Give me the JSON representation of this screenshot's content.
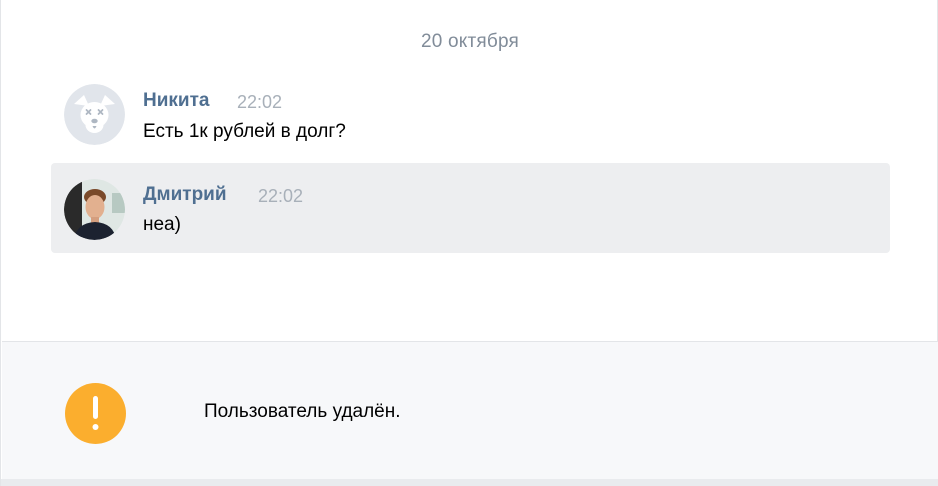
{
  "date_separator": "20 октября",
  "messages": [
    {
      "author": "Никита",
      "time": "22:02",
      "text": "Есть 1к рублей в долг?"
    },
    {
      "author": "Дмитрий",
      "time": "22:02",
      "text": "неа)"
    }
  ],
  "notice": {
    "text": "Пользователь удалён.",
    "icon": "warning-icon",
    "color": "#fbae2e"
  },
  "colors": {
    "author": "#4f6f91",
    "highlight_bg": "#edeef0",
    "muted": "#818c99"
  }
}
